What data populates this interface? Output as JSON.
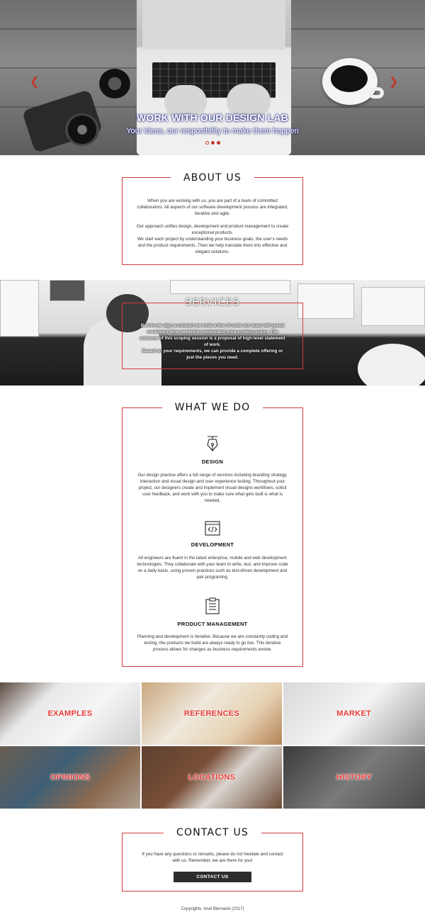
{
  "hero": {
    "title": "WORK WITH OUR DESIGN LAB",
    "subtitle": "Your ideas, our resposibility to make them happen",
    "prev_arrow": "❮",
    "next_arrow": "❯",
    "slides": 3,
    "active_slide": 1
  },
  "about": {
    "title": "ABOUT US",
    "paragraphs": [
      "When you are working with us, you are part of a team of committed collaborators. All aspects of our software development process are integrated, iterative and agile.",
      "Our approach unifies design, development and product management to create exceptional products.",
      "We start each project by understanding your business goals, the user's needs and the product requirements. Then we help translate them into effective and elegant solutions."
    ]
  },
  "services": {
    "title": "SERVICES",
    "paragraphs": [
      "Before we sign a contract we write a line of code our team will spend necessary time needed to understand your product vision. The outcome of this scoping session is a proposal of high-level statement of work.",
      "Based on your requirements, we can provide a complete offering or just the pieces you need."
    ]
  },
  "what_we_do": {
    "title": "WHAT WE DO",
    "items": [
      {
        "icon": "pen-tool-icon",
        "heading": "DESIGN",
        "text": "Our design practice offers a full range of services including branding strategy, interaction and visual design and user experience testing. Throughout your project, our designers create and implement visual designs workflows, solicit user feedback, and work with you to make sure what gets built is what is needed."
      },
      {
        "icon": "code-icon",
        "heading": "DEVELOPMENT",
        "text": "All engineers are fluent in the latest enterprise, mobile and web development technologies. They collaborate with your team to write, test, and improve code on a daily basis, using proven practices such as test-driven development and pair programing."
      },
      {
        "icon": "clipboard-icon",
        "heading": "PRODUCT MANAGEMENT",
        "text": "Planning and development is iterative. Because we are constantly coding and testing, the products we build are always ready to go live. This iterative process allows for changes as business requirements evolve."
      }
    ]
  },
  "gallery": {
    "tiles": [
      "EXAMPLES",
      "REFERENCES",
      "MARKET",
      "OPINIONS",
      "LOCATIONS",
      "HISTORY"
    ]
  },
  "contact": {
    "title": "CONTACT US",
    "text": "If you have any questions or remarks, please do not hesitate and contact with us. Remember, we are there for you!",
    "button": "CONTACT US"
  },
  "footer": {
    "text": "Copyrights: Ariel Biernacki (2017)"
  },
  "colors": {
    "accent": "#d63b3b",
    "button_bg": "#2d2d2d",
    "hero_text_glow": "#1a237e"
  }
}
